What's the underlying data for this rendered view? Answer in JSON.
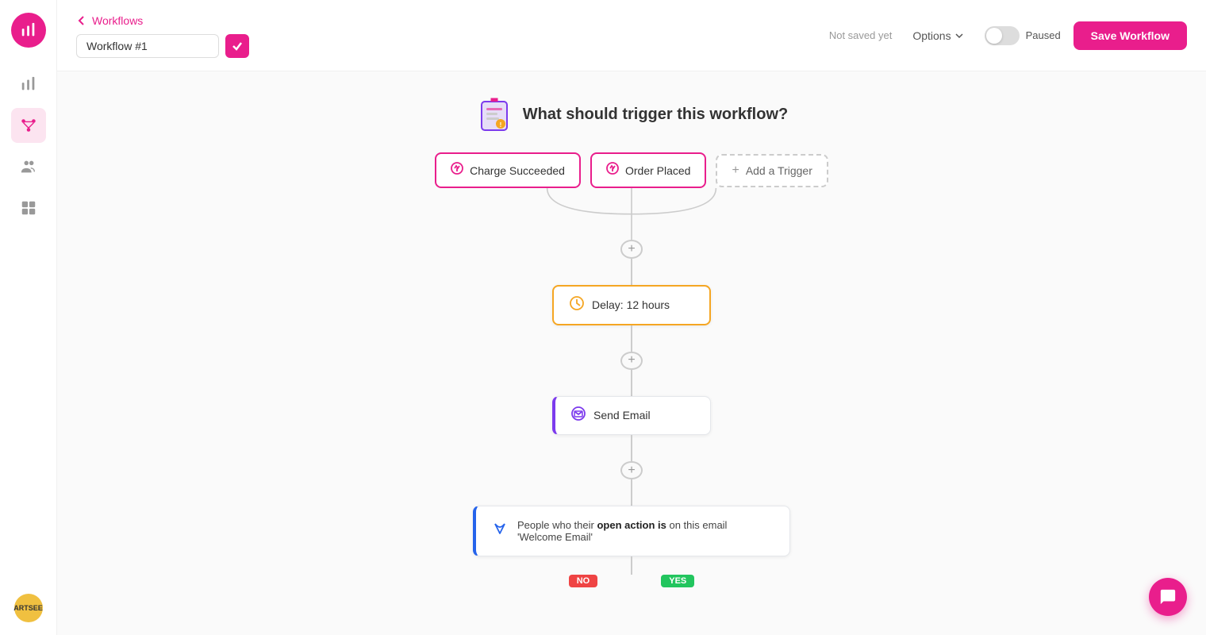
{
  "app": {
    "logo_label": "App Logo"
  },
  "sidebar": {
    "items": [
      {
        "id": "analytics",
        "label": "Analytics",
        "active": false
      },
      {
        "id": "workflows",
        "label": "Workflows",
        "active": true
      },
      {
        "id": "people",
        "label": "People",
        "active": false
      },
      {
        "id": "products",
        "label": "Products",
        "active": false
      }
    ],
    "avatar_text": "ARTSEE"
  },
  "header": {
    "back_label": "Workflows",
    "workflow_name": "Workflow #1",
    "not_saved_label": "Not saved yet",
    "options_label": "Options",
    "paused_label": "Paused",
    "save_button_label": "Save Workflow"
  },
  "canvas": {
    "trigger_question": "What should trigger this workflow?",
    "triggers": [
      {
        "id": "charge",
        "label": "Charge Succeeded"
      },
      {
        "id": "order",
        "label": "Order Placed"
      },
      {
        "id": "add",
        "label": "Add a Trigger"
      }
    ],
    "steps": [
      {
        "id": "delay",
        "type": "delay",
        "label": "Delay: 12 hours"
      },
      {
        "id": "email",
        "type": "email",
        "label": "Send Email"
      }
    ],
    "condition": {
      "text_prefix": "People who their ",
      "action_bold": "open action is",
      "text_mid": " on this email",
      "email_name": "'Welcome Email'",
      "icon": "filter"
    },
    "branches": [
      {
        "label": "NO",
        "type": "no"
      },
      {
        "label": "YES",
        "type": "yes"
      }
    ]
  }
}
